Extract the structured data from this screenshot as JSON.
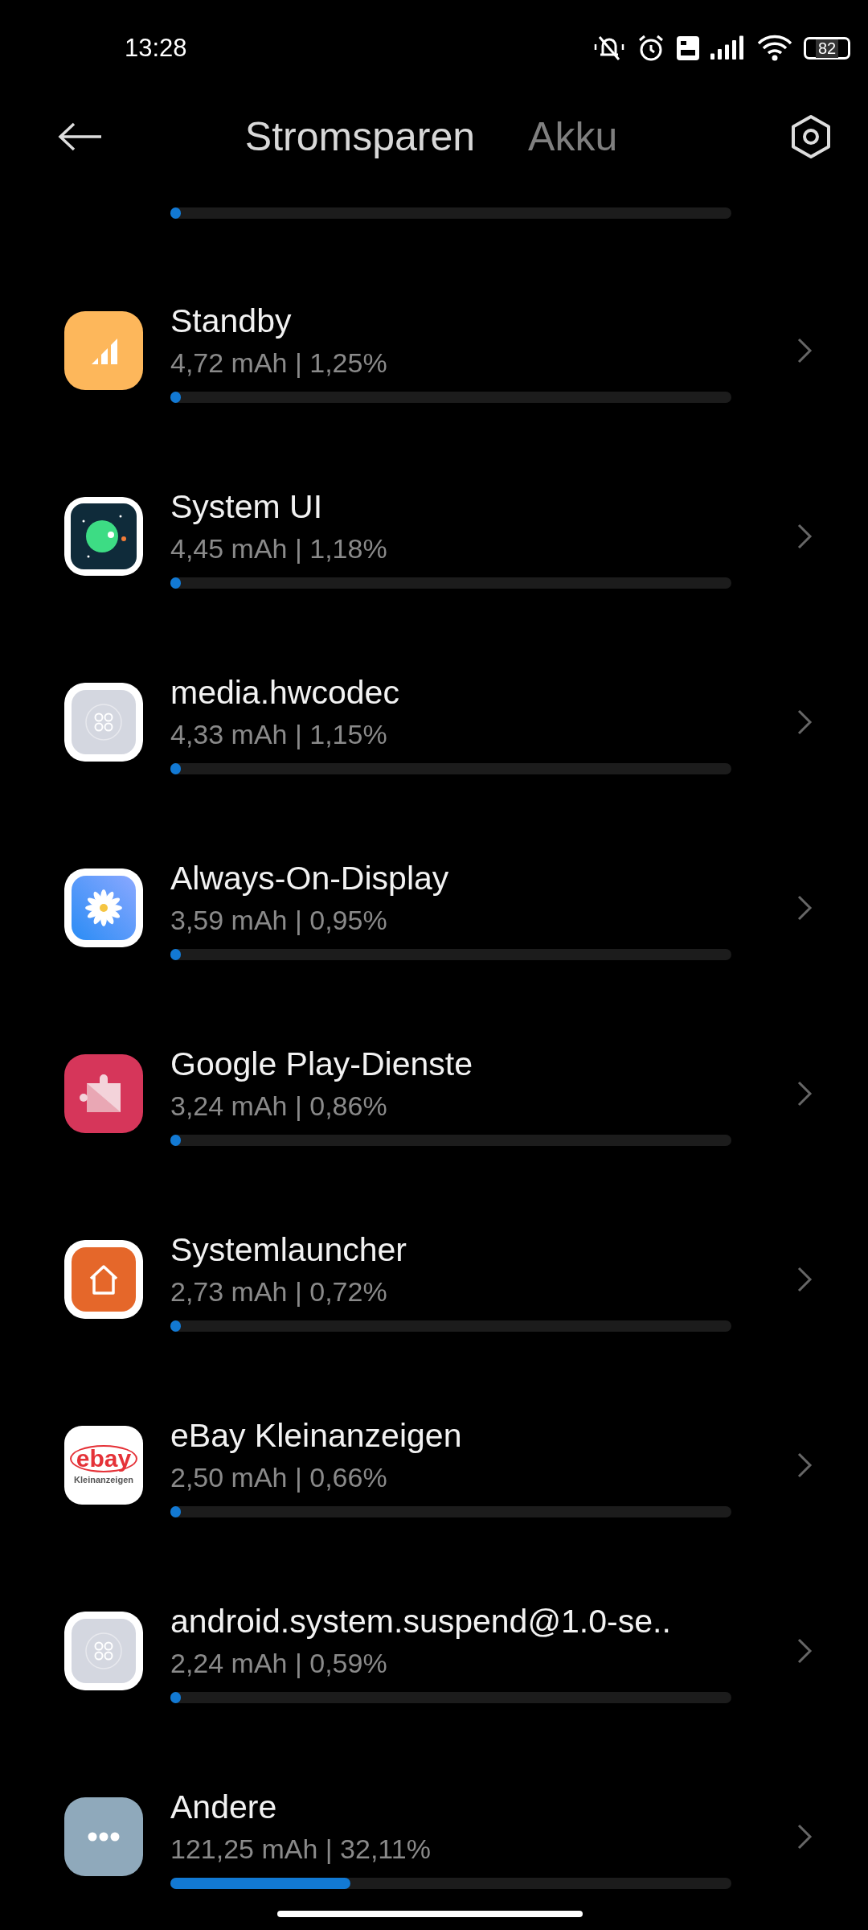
{
  "status_bar": {
    "time": "13:28",
    "battery": "82"
  },
  "tabs": [
    {
      "label": "Stromsparen",
      "selected": true
    },
    {
      "label": "Akku",
      "selected": false
    }
  ],
  "total_bar": {
    "level": 0.01
  },
  "apps": [
    {
      "kind": "signal",
      "name": "Standby",
      "usage": "4,72 mAh | 1,25%",
      "level": 0.0125
    },
    {
      "kind": "android",
      "name": "System UI",
      "usage": "4,45 mAh | 1,18%",
      "level": 0.0118
    },
    {
      "kind": "generic",
      "name": "media.hwcodec",
      "usage": "4,33 mAh | 1,15%",
      "level": 0.0115
    },
    {
      "kind": "flower",
      "name": "Always-On-Display",
      "usage": "3,59 mAh | 0,95%",
      "level": 0.0095
    },
    {
      "kind": "puzzle",
      "name": "Google Play-Dienste",
      "usage": "3,24 mAh | 0,86%",
      "level": 0.0086
    },
    {
      "kind": "home",
      "name": "Systemlauncher",
      "usage": "2,73 mAh | 0,72%",
      "level": 0.0072
    },
    {
      "kind": "ebay",
      "name": "eBay Kleinanzeigen",
      "usage": "2,50 mAh | 0,66%",
      "level": 0.0066,
      "logo": [
        "ebay",
        "Kleinanzeigen"
      ]
    },
    {
      "kind": "generic",
      "name": "android.system.suspend@1.0-se..",
      "usage": "2,24 mAh | 0,59%",
      "level": 0.0059
    },
    {
      "kind": "dots",
      "name": "Andere",
      "usage": "121,25 mAh | 32,11%",
      "level": 0.3211
    }
  ]
}
